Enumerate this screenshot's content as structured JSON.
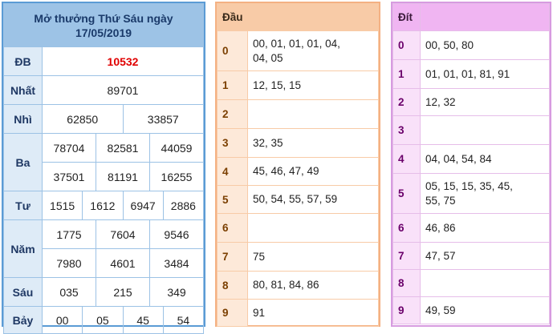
{
  "title_line1": "Mở thưởng Thứ Sáu ngày",
  "title_line2": "17/05/2019",
  "prizes": {
    "db": {
      "label": "ĐB",
      "values": [
        "10532"
      ]
    },
    "nhat": {
      "label": "Nhất",
      "values": [
        "89701"
      ]
    },
    "nhi": {
      "label": "Nhì",
      "values": [
        "62850",
        "33857"
      ]
    },
    "ba": {
      "label": "Ba",
      "values": [
        "78704",
        "82581",
        "44059",
        "37501",
        "81191",
        "16255"
      ]
    },
    "tu": {
      "label": "Tư",
      "values": [
        "1515",
        "1612",
        "6947",
        "2886"
      ]
    },
    "nam": {
      "label": "Năm",
      "values": [
        "1775",
        "7604",
        "9546",
        "7980",
        "4601",
        "3484"
      ]
    },
    "sau": {
      "label": "Sáu",
      "values": [
        "035",
        "215",
        "349"
      ]
    },
    "bay": {
      "label": "Bảy",
      "values": [
        "00",
        "05",
        "45",
        "54"
      ]
    }
  },
  "dau": {
    "header": "Đầu",
    "rows": [
      {
        "key": "0",
        "line1": "00, 01, 01, 01, 04,",
        "line2": "04, 05"
      },
      {
        "key": "1",
        "line1": "12, 15, 15",
        "line2": ""
      },
      {
        "key": "2",
        "line1": "",
        "line2": ""
      },
      {
        "key": "3",
        "line1": "32, 35",
        "line2": ""
      },
      {
        "key": "4",
        "line1": "45, 46, 47, 49",
        "line2": ""
      },
      {
        "key": "5",
        "line1": "50, 54, 55, 57, 59",
        "line2": ""
      },
      {
        "key": "6",
        "line1": "",
        "line2": ""
      },
      {
        "key": "7",
        "line1": "75",
        "line2": ""
      },
      {
        "key": "8",
        "line1": "80, 81, 84, 86",
        "line2": ""
      },
      {
        "key": "9",
        "line1": "91",
        "line2": ""
      }
    ]
  },
  "dit": {
    "header": "Đít",
    "rows": [
      {
        "key": "0",
        "line1": "00, 50, 80",
        "line2": ""
      },
      {
        "key": "1",
        "line1": "01, 01, 01, 81, 91",
        "line2": ""
      },
      {
        "key": "2",
        "line1": "12, 32",
        "line2": ""
      },
      {
        "key": "3",
        "line1": "",
        "line2": ""
      },
      {
        "key": "4",
        "line1": "04, 04, 54, 84",
        "line2": ""
      },
      {
        "key": "5",
        "line1": "05, 15, 15, 35, 45,",
        "line2": "55, 75"
      },
      {
        "key": "6",
        "line1": "46, 86",
        "line2": ""
      },
      {
        "key": "7",
        "line1": "47, 57",
        "line2": ""
      },
      {
        "key": "8",
        "line1": "",
        "line2": ""
      },
      {
        "key": "9",
        "line1": "49, 59",
        "line2": ""
      }
    ]
  },
  "colors": {
    "special_prize": "#e00000",
    "results_border": "#5b9bd5",
    "dau_border": "#f4b183",
    "dit_border": "#d79be0"
  }
}
